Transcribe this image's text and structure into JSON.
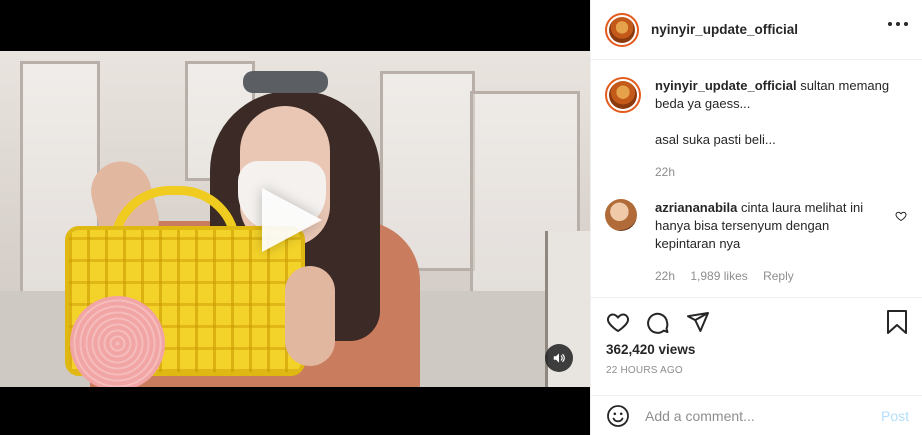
{
  "post": {
    "author": "nyinyir_update_official"
  },
  "caption": {
    "username": "nyinyir_update_official",
    "text": " sultan memang beda ya gaess...",
    "line2": "asal suka pasti beli...",
    "time": "22h"
  },
  "comments": [
    {
      "username": "azriananabila",
      "text": " cinta laura melihat ini hanya bisa tersenyum dengan kepintaran nya",
      "time": "22h",
      "likes": "1,989 likes",
      "reply": "Reply"
    }
  ],
  "stats": {
    "views": "362,420 views",
    "time_ago": "22 HOURS AGO"
  },
  "comment_box": {
    "placeholder": "Add a comment...",
    "post_label": "Post"
  },
  "icons": {
    "more": "more-options-icon",
    "like": "heart-icon",
    "comment": "comment-icon",
    "share": "share-icon",
    "save": "bookmark-icon",
    "emoji": "emoji-icon",
    "play": "play-icon",
    "sound": "sound-icon"
  },
  "colors": {
    "avatar_ring": "#e55a1d",
    "post_button": "#b2dffc",
    "muted_text": "#8e8e8e"
  }
}
